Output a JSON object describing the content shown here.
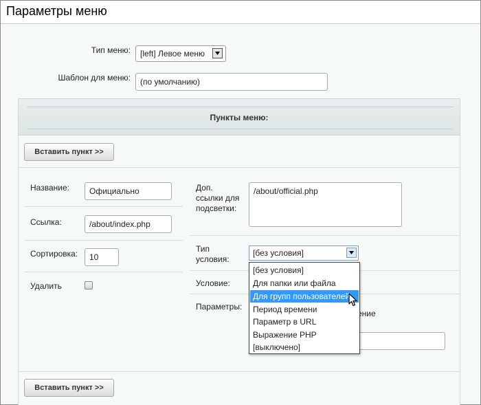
{
  "title": "Параметры меню",
  "menu_type": {
    "label": "Тип меню:",
    "value": "[left] Левое меню"
  },
  "template": {
    "label": "Шаблон для меню:",
    "value": "(по умолчанию)"
  },
  "items_section": {
    "title": "Пункты меню:"
  },
  "insert_button": "Вставить пункт >>",
  "item": {
    "name_label": "Название:",
    "name_value": "Официально",
    "link_label": "Ссылка:",
    "link_value": "/about/index.php",
    "sort_label": "Сортировка:",
    "sort_value": "10",
    "delete_label": "Удалить",
    "extra_links_label_1": "Доп.",
    "extra_links_label_2": "ссылки для",
    "extra_links_label_3": "подсветки:",
    "extra_links_value": "/about/official.php",
    "cond_type_label_1": "Тип",
    "cond_type_label_2": "условия:",
    "cond_type_value": "[без условия]",
    "condition_label": "Условие:",
    "params_label": "Параметры:",
    "params_partial_text": "ение"
  },
  "dropdown": {
    "options": [
      "[без условия]",
      "Для папки или файла",
      "Для групп пользователей",
      "Период времени",
      "Параметр в URL",
      "Выражение PHP",
      "[выключено]"
    ],
    "highlighted": "Для групп пользователей"
  },
  "colors": {
    "highlight": "#3399ff",
    "panel_bg": "#f5f9f9"
  }
}
